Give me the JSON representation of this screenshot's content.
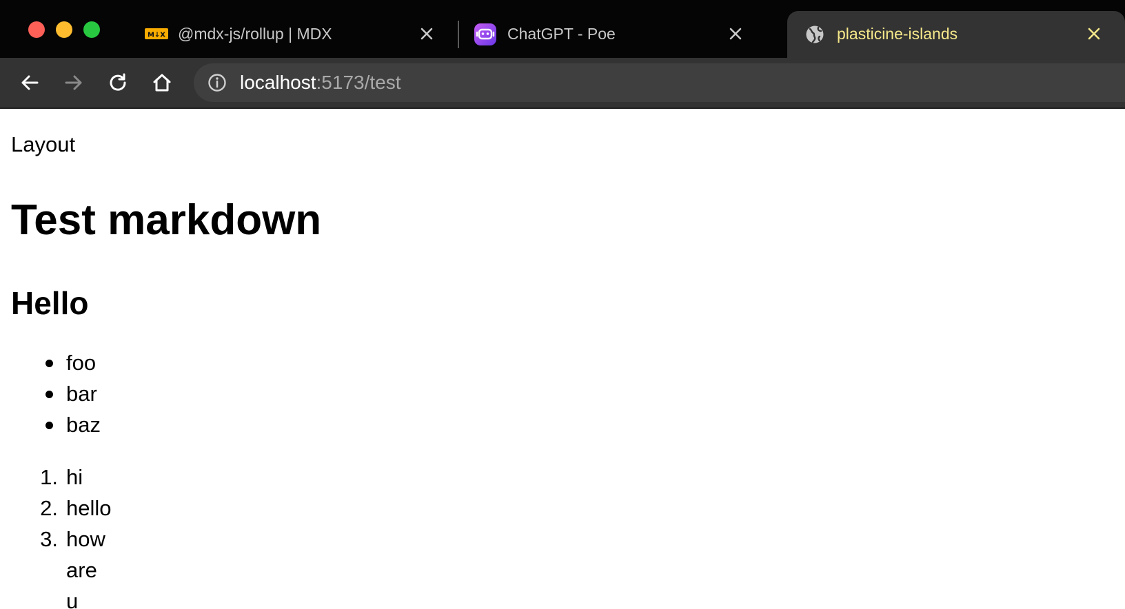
{
  "browser": {
    "tabs": [
      {
        "title": "@mdx-js/rollup | MDX",
        "icon": "mdx-logo-icon",
        "active": false
      },
      {
        "title": "ChatGPT - Poe",
        "icon": "poe-bot-icon",
        "active": false
      },
      {
        "title": "plasticine-islands",
        "icon": "globe-icon",
        "active": true
      }
    ],
    "address_bar": {
      "host": "localhost",
      "path": ":5173/test"
    },
    "colors": {
      "tabstrip_bg": "#050505",
      "active_tab_bg": "#333333",
      "active_tab_text": "#f5e88a",
      "mdx_accent": "#f9ac00"
    }
  },
  "page": {
    "layout_label": "Layout",
    "heading1": "Test markdown",
    "heading2": "Hello",
    "unordered_list": [
      "foo",
      "bar",
      "baz"
    ],
    "ordered_list": [
      {
        "number": "1.",
        "text": "hi"
      },
      {
        "number": "2.",
        "text": "hello"
      },
      {
        "number": "3.",
        "text": "how are u"
      }
    ]
  }
}
